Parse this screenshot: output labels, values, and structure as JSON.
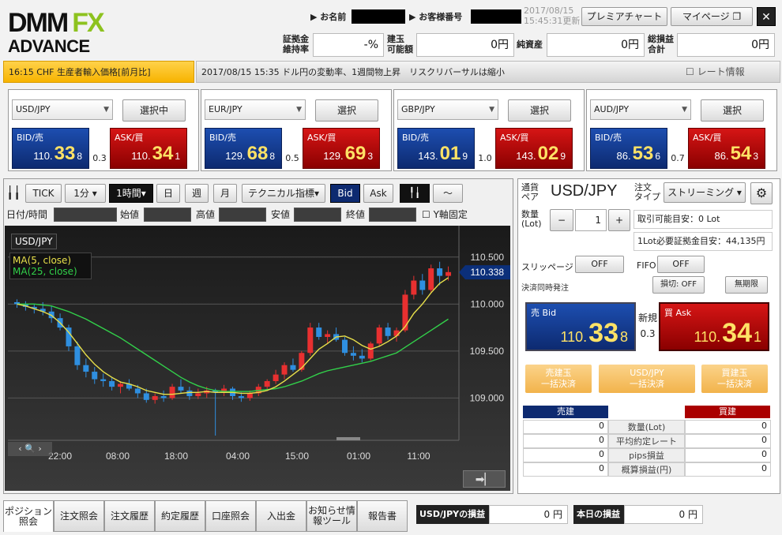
{
  "brand": {
    "line1": "DMM",
    "fx": "FX",
    "line2": "ADVANCE"
  },
  "header": {
    "name_label": "お名前",
    "cust_label": "お客様番号",
    "updated": "2017/08/15",
    "updated2": "15:45:31更新",
    "premier": "プレミアチャート",
    "mypage": "マイページ",
    "close": "✕"
  },
  "account": {
    "ratio_label1": "証拠金",
    "ratio_label2": "維持率",
    "ratio_value": "-%",
    "avail_label1": "建玉",
    "avail_label2": "可能額",
    "avail_value": "0円",
    "net_label": "純資産",
    "net_value": "0円",
    "pl_label1": "総損益",
    "pl_label2": "合計",
    "pl_value": "0円"
  },
  "ticker": {
    "left": "16:15 CHF 生産者輸入価格[前月比]",
    "right": "2017/08/15 15:35 ドル円の変動率、1週間物上昇　リスクリバーサルは縮小",
    "rate_info": "レート情報"
  },
  "panels": [
    {
      "pair": "USD/JPY",
      "button": "選択中",
      "bid_label": "BID/売",
      "ask_label": "ASK/買",
      "bid_s": "110.",
      "bid_b": "33",
      "bid_e": "8",
      "ask_s": "110.",
      "ask_b": "34",
      "ask_e": "1",
      "spread": "0.3"
    },
    {
      "pair": "EUR/JPY",
      "button": "選択",
      "bid_label": "BID/売",
      "ask_label": "ASK/買",
      "bid_s": "129.",
      "bid_b": "68",
      "bid_e": "8",
      "ask_s": "129.",
      "ask_b": "69",
      "ask_e": "3",
      "spread": "0.5"
    },
    {
      "pair": "GBP/JPY",
      "button": "選択",
      "bid_label": "BID/売",
      "ask_label": "ASK/買",
      "bid_s": "143.",
      "bid_b": "01",
      "bid_e": "9",
      "ask_s": "143.",
      "ask_b": "02",
      "ask_e": "9",
      "spread": "1.0"
    },
    {
      "pair": "AUD/JPY",
      "button": "選択",
      "bid_label": "BID/売",
      "ask_label": "ASK/買",
      "bid_s": "86.",
      "bid_b": "53",
      "bid_e": "6",
      "ask_s": "86.",
      "ask_b": "54",
      "ask_e": "3",
      "spread": "0.7"
    }
  ],
  "chart_toolbar": {
    "tick": "TICK",
    "min": "1分",
    "hour": "1時間",
    "day": "日",
    "week": "週",
    "month": "月",
    "tech": "テクニカル指標",
    "bid": "Bid",
    "ask": "Ask"
  },
  "chart_inputs": {
    "date": "日付/時間",
    "open": "始値",
    "high": "高値",
    "low": "安値",
    "close": "終値",
    "yfix": "Y軸固定"
  },
  "chart_data": {
    "type": "candlestick",
    "pair_label": "USD/JPY",
    "legend": [
      "MA(5, close)",
      "MA(25, close)"
    ],
    "y_ticks": [
      "110.500",
      "110.000",
      "109.500",
      "109.000"
    ],
    "x_ticks": [
      "22:00",
      "08:00",
      "18:00",
      "04:00",
      "15:00",
      "01:00",
      "11:00"
    ],
    "current": "110.338",
    "ylim": [
      108.55,
      110.75
    ],
    "candles": [
      [
        110.02,
        110.05,
        109.96,
        110.0
      ],
      [
        110.0,
        110.03,
        109.93,
        109.97
      ],
      [
        109.97,
        110.0,
        109.9,
        109.95
      ],
      [
        109.95,
        110.02,
        109.88,
        109.92
      ],
      [
        109.92,
        109.98,
        109.8,
        109.85
      ],
      [
        109.85,
        109.9,
        109.72,
        109.75
      ],
      [
        109.75,
        109.78,
        109.5,
        109.55
      ],
      [
        109.55,
        109.6,
        109.3,
        109.35
      ],
      [
        109.35,
        109.42,
        109.22,
        109.28
      ],
      [
        109.28,
        109.33,
        109.15,
        109.2
      ],
      [
        109.2,
        109.26,
        109.12,
        109.18
      ],
      [
        109.18,
        109.22,
        109.08,
        109.12
      ],
      [
        109.12,
        109.18,
        109.05,
        109.15
      ],
      [
        109.15,
        109.2,
        109.08,
        109.1
      ],
      [
        109.1,
        109.14,
        109.0,
        109.05
      ],
      [
        109.05,
        109.1,
        108.95,
        108.98
      ],
      [
        108.98,
        109.05,
        108.94,
        109.02
      ],
      [
        109.02,
        109.08,
        108.96,
        109.0
      ],
      [
        109.0,
        109.15,
        108.98,
        109.12
      ],
      [
        109.12,
        109.2,
        109.05,
        109.08
      ],
      [
        109.08,
        109.12,
        108.98,
        109.02
      ],
      [
        109.02,
        109.1,
        108.99,
        109.05
      ],
      [
        109.05,
        109.12,
        109.0,
        109.08
      ],
      [
        109.08,
        109.1,
        108.6,
        109.06
      ],
      [
        109.06,
        109.14,
        109.02,
        109.1
      ],
      [
        109.1,
        109.12,
        108.98,
        109.02
      ],
      [
        109.02,
        109.06,
        108.96,
        109.0
      ],
      [
        109.0,
        109.08,
        108.97,
        109.05
      ],
      [
        109.05,
        109.15,
        109.02,
        109.12
      ],
      [
        109.12,
        109.2,
        109.08,
        109.18
      ],
      [
        109.18,
        109.3,
        109.15,
        109.25
      ],
      [
        109.25,
        109.38,
        109.2,
        109.35
      ],
      [
        109.35,
        109.42,
        109.28,
        109.3
      ],
      [
        109.3,
        109.5,
        109.28,
        109.48
      ],
      [
        109.48,
        109.8,
        109.45,
        109.75
      ],
      [
        109.75,
        109.8,
        109.62,
        109.65
      ],
      [
        109.65,
        109.72,
        109.58,
        109.68
      ],
      [
        109.68,
        109.75,
        109.6,
        109.62
      ],
      [
        109.62,
        109.65,
        109.45,
        109.48
      ],
      [
        109.48,
        109.55,
        109.4,
        109.45
      ],
      [
        109.45,
        109.52,
        109.38,
        109.42
      ],
      [
        109.42,
        109.6,
        109.4,
        109.58
      ],
      [
        109.58,
        109.78,
        109.55,
        109.75
      ],
      [
        109.75,
        109.8,
        109.62,
        109.66
      ],
      [
        109.66,
        109.75,
        109.6,
        109.72
      ],
      [
        109.72,
        110.15,
        109.7,
        110.1
      ],
      [
        110.1,
        110.3,
        110.05,
        110.25
      ],
      [
        110.25,
        110.32,
        110.1,
        110.15
      ],
      [
        110.15,
        110.42,
        110.12,
        110.38
      ],
      [
        110.38,
        110.45,
        110.2,
        110.3
      ],
      [
        110.3,
        110.4,
        110.25,
        110.34
      ]
    ],
    "ma5": [
      110.0,
      109.98,
      109.95,
      109.92,
      109.88,
      109.8,
      109.7,
      109.58,
      109.46,
      109.36,
      109.28,
      109.22,
      109.17,
      109.15,
      109.12,
      109.08,
      109.06,
      109.04,
      109.04,
      109.05,
      109.06,
      109.06,
      109.07,
      109.06,
      109.06,
      109.06,
      109.05,
      109.05,
      109.06,
      109.08,
      109.12,
      109.18,
      109.25,
      109.32,
      109.42,
      109.52,
      109.58,
      109.65,
      109.66,
      109.62,
      109.56,
      109.52,
      109.55,
      109.6,
      109.66,
      109.76,
      109.9,
      110.0,
      110.12,
      110.22,
      110.28
    ],
    "ma25": [
      110.0,
      110.0,
      110.0,
      109.99,
      109.98,
      109.95,
      109.92,
      109.88,
      109.84,
      109.79,
      109.74,
      109.69,
      109.64,
      109.58,
      109.52,
      109.46,
      109.4,
      109.34,
      109.28,
      109.22,
      109.17,
      109.13,
      109.1,
      109.08,
      109.07,
      109.07,
      109.07,
      109.07,
      109.08,
      109.09,
      109.1,
      109.12,
      109.15,
      109.18,
      109.22,
      109.26,
      109.29,
      109.31,
      109.33,
      109.35,
      109.37,
      109.39,
      109.42,
      109.45,
      109.48,
      109.54,
      109.6,
      109.66,
      109.72,
      109.78,
      109.84
    ]
  },
  "order": {
    "pair_label1": "通貨",
    "pair_label2": "ペア",
    "pair": "USD/JPY",
    "type_label1": "注文",
    "type_label2": "タイプ",
    "type": "ストリーミング",
    "qty_label1": "数量",
    "qty_label2": "(Lot)",
    "qty": "1",
    "minus": "−",
    "plus": "+",
    "tradable": "取引可能目安：0 Lot",
    "margin": "1Lot必要証拠金目安：44,135円",
    "slip_label": "スリッページ",
    "slip": "OFF",
    "fifo_label": "FIFO",
    "fifo": "OFF",
    "settle_label": "決済同時発注",
    "stop": "損切: OFF",
    "unlimited": "無期限",
    "bid_label": "売 Bid",
    "ask_label": "買 Ask",
    "new_label": "新規",
    "spread": "0.3",
    "bid_s": "110.",
    "bid_b": "33",
    "bid_e": "8",
    "ask_s": "110.",
    "ask_b": "34",
    "ask_e": "1",
    "btn_sell1": "売建玉",
    "btn_sell2": "一括決済",
    "btn_pair1": "USD/JPY",
    "btn_pair2": "一括決済",
    "btn_buy1": "買建玉",
    "btn_buy2": "一括決済"
  },
  "positions": {
    "sell": "売建",
    "buy": "買建",
    "rows": [
      [
        "0",
        "数量(Lot)",
        "0"
      ],
      [
        "0",
        "平均約定レート",
        "0"
      ],
      [
        "0",
        "pips損益",
        "0"
      ],
      [
        "0",
        "概算損益(円)",
        "0"
      ]
    ]
  },
  "tabs": [
    "ポジション照会",
    "注文照会",
    "注文履歴",
    "約定履歴",
    "口座照会",
    "入出金",
    "お知らせ情報ツール",
    "報告書"
  ],
  "footer": {
    "pair_pl_label": "USD/JPYの損益",
    "pair_pl": "0 円",
    "day_pl_label": "本日の損益",
    "day_pl": "0 円"
  }
}
